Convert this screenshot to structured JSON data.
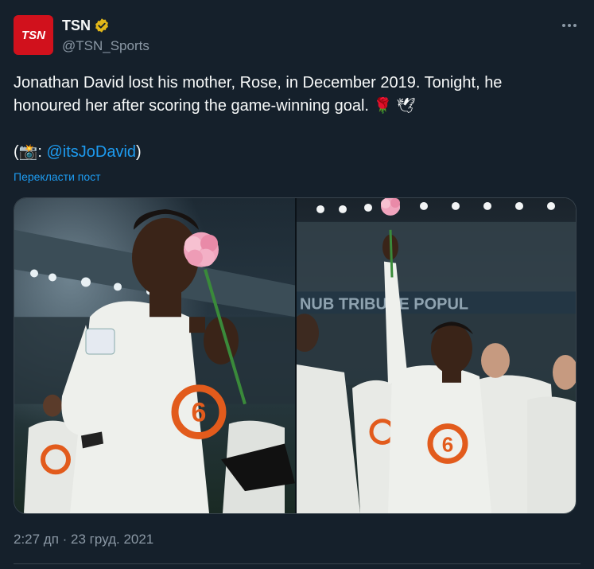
{
  "account": {
    "display_name": "TSN",
    "handle": "@TSN_Sports",
    "avatar_icon": "tsn-logo-icon",
    "verified_icon": "verified-badge-icon",
    "brand_color": "#d1111c",
    "badge_color": "#e2b719"
  },
  "tweet": {
    "line1": "Jonathan David lost his mother, Rose, in December 2019. Tonight, he",
    "line2": "honoured her after scoring the game-winning goal.",
    "line2_emojis": "🌹 🕊",
    "credit_open": "(",
    "credit_emoji": "📸",
    "credit_sep": ": ",
    "credit_mention": "@itsJoDavid",
    "credit_close": ")"
  },
  "translate_label": "Перекласти пост",
  "media": {
    "photos": [
      {
        "icon": "photo-player-kissing-rose"
      },
      {
        "icon": "photo-player-raising-rose"
      }
    ]
  },
  "timestamp": "2:27 дп · 23 груд. 2021",
  "more_icon": "more-horizontal-icon",
  "colors": {
    "background": "#15202b",
    "text": "#f7f9f9",
    "secondary": "#8b98a5",
    "link": "#1d9bf0"
  }
}
